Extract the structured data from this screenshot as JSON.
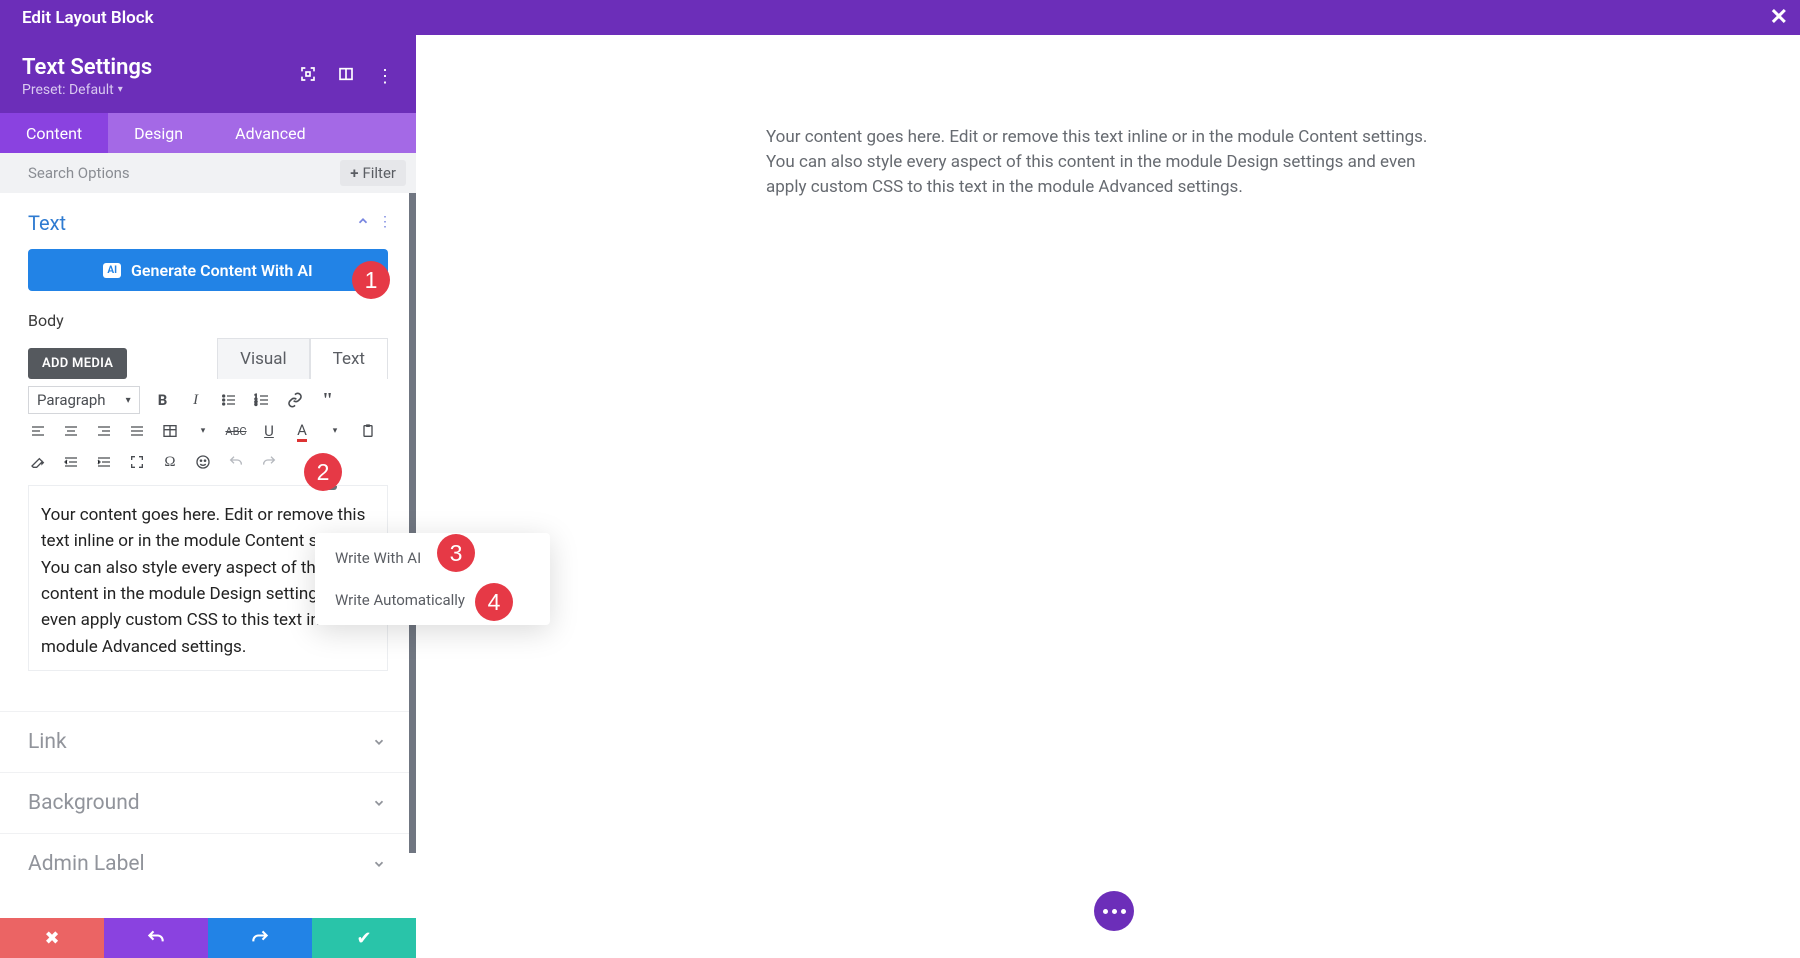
{
  "titlebar": {
    "title": "Edit Layout Block"
  },
  "subheader": {
    "title": "Text Settings",
    "preset_label": "Preset: Default"
  },
  "tabs": {
    "content": "Content",
    "design": "Design",
    "advanced": "Advanced"
  },
  "search": {
    "placeholder": "Search Options",
    "filter_label": "Filter"
  },
  "sections": {
    "text": "Text",
    "link": "Link",
    "background": "Background",
    "admin_label": "Admin Label"
  },
  "ai_button": "Generate Content With AI",
  "body_label": "Body",
  "add_media": "ADD MEDIA",
  "editor_tabs": {
    "visual": "Visual",
    "text": "Text"
  },
  "paragraph_sel": "Paragraph",
  "editor_content": "Your content goes here. Edit or remove this text inline or in the module Content settings. You can also style every aspect of this content in the module Design settings and even apply custom CSS to this text in the module Advanced settings.",
  "floatmenu": {
    "write_with_ai": "Write With AI",
    "write_auto": "Write Automatically"
  },
  "preview_text": "Your content goes here. Edit or remove this text inline or in the module Content settings. You can also style every aspect of this content in the module Design settings and even apply custom CSS to this text in the module Advanced settings.",
  "badges": {
    "b1": "1",
    "b2": "2",
    "b3": "3",
    "b4": "4"
  },
  "colors": {
    "primary": "#6c2eb9",
    "tab_bg": "#a469e6",
    "tab_active": "#8a42e0",
    "ai_blue": "#2283e6",
    "badge_red": "#e63946",
    "save_green": "#29c4a9",
    "cancel_red": "#eb6464"
  }
}
